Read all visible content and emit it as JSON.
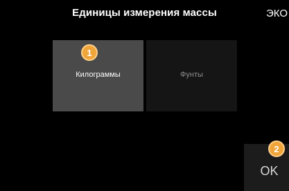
{
  "screen": {
    "title": "Единицы измерения массы",
    "mode_label": "ЭКО"
  },
  "options": [
    {
      "label": "Килограммы",
      "selected": true
    },
    {
      "label": "Фунты",
      "selected": false
    }
  ],
  "ok_button": {
    "label": "OK"
  },
  "callouts": [
    {
      "number": "1"
    },
    {
      "number": "2"
    }
  ],
  "colors": {
    "background": "#000000",
    "selected_tile": "#4a4a4a",
    "unselected_tile": "#151515",
    "ok_button": "#1c1c1c",
    "callout": "#f0a53a"
  }
}
